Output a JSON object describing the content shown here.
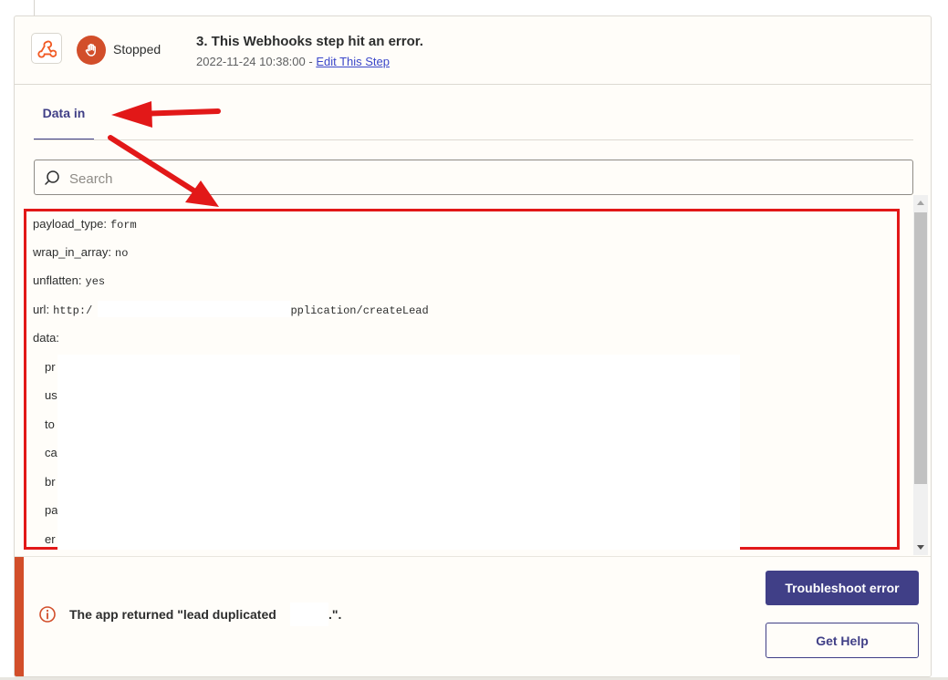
{
  "step": {
    "status": "Stopped",
    "title": "3. This Webhooks step hit an error.",
    "timestamp": "2022-11-24 10:38:00",
    "separator": " - ",
    "edit_link": "Edit This Step",
    "app_icon": "webhook-icon",
    "status_icon": "hand-stop-icon"
  },
  "tabs": [
    {
      "label": "Data in",
      "active": true
    }
  ],
  "search": {
    "placeholder": "Search",
    "value": ""
  },
  "data_fields": [
    {
      "key": "payload_type:",
      "value": "form"
    },
    {
      "key": "wrap_in_array:",
      "value": "no"
    },
    {
      "key": "unflatten:",
      "value": "yes"
    },
    {
      "key": "url:",
      "value": "http:/",
      "value_suffix": "application/createLead"
    },
    {
      "key": "data:",
      "value": ""
    }
  ],
  "data_children": [
    "pr",
    "us",
    "to",
    "ca",
    "br",
    "pa",
    "er"
  ],
  "error": {
    "message": "The app returned \"lead duplicated",
    "message_end": ".\".",
    "icon": "info-circle-icon"
  },
  "buttons": {
    "troubleshoot": "Troubleshoot error",
    "get_help": "Get Help"
  },
  "colors": {
    "accent": "#403f87",
    "error": "#d24e2a",
    "annotation_red": "#e21818",
    "link": "#3a46c9"
  }
}
